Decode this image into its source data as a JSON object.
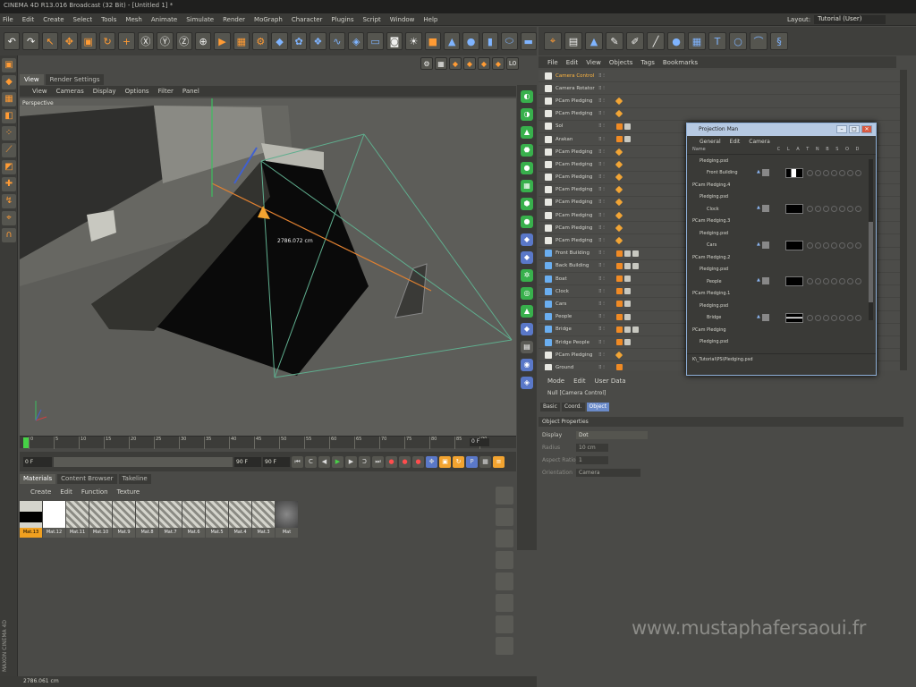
{
  "app": {
    "title": "CINEMA 4D R13.016 Broadcast (32 Bit) - [Untitled 1] *",
    "layout_label": "Layout:",
    "layout_value": "Tutorial (User)"
  },
  "menu": [
    "File",
    "Edit",
    "Create",
    "Select",
    "Tools",
    "Mesh",
    "Animate",
    "Simulate",
    "Render",
    "MoGraph",
    "Character",
    "Plugins",
    "Script",
    "Window",
    "Help"
  ],
  "viewport": {
    "tabs": [
      "View",
      "Render Settings"
    ],
    "menu": [
      "View",
      "Cameras",
      "Display",
      "Options",
      "Filter",
      "Panel"
    ],
    "label": "Perspective",
    "measure": "2786.072 cm"
  },
  "timeline": {
    "ticks": [
      "0",
      "5",
      "10",
      "15",
      "20",
      "25",
      "30",
      "35",
      "40",
      "45",
      "50",
      "55",
      "60",
      "65",
      "70",
      "75",
      "80",
      "85",
      "90"
    ],
    "frame_end": "0 F",
    "start": "0 F",
    "end_field": "90 F",
    "range_end": "90 F"
  },
  "materials": {
    "tabs": [
      "Materials",
      "Content Browser",
      "Takeline"
    ],
    "menu": [
      "Create",
      "Edit",
      "Function",
      "Texture"
    ],
    "items": [
      "Mat.13",
      "Mat.12",
      "Mat.11",
      "Mat.10",
      "Mat.9",
      "Mat.8",
      "Mat.7",
      "Mat.6",
      "Mat.5",
      "Mat.4",
      "Mat.3",
      "Mat"
    ],
    "selected_index": 0
  },
  "status": {
    "text": "2786.061 cm"
  },
  "side_logo": "MAXON CINEMA 4D",
  "object_manager": {
    "menu": [
      "File",
      "Edit",
      "View",
      "Objects",
      "Tags",
      "Bookmarks"
    ],
    "rows": [
      {
        "name": "Camera Control",
        "type": "null",
        "highlight": true,
        "tags": []
      },
      {
        "name": "Camera Rotator",
        "type": "null",
        "highlight": false,
        "tags": []
      },
      {
        "name": "PCam Pledging",
        "type": "obj",
        "highlight": false,
        "tags": [
          "c"
        ]
      },
      {
        "name": "PCam Pledging",
        "type": "obj",
        "highlight": false,
        "tags": [
          "c"
        ]
      },
      {
        "name": "Sol",
        "type": "obj",
        "highlight": false,
        "tags": [
          "o",
          "x"
        ]
      },
      {
        "name": "Arakan",
        "type": "obj",
        "highlight": false,
        "tags": [
          "o",
          "x"
        ]
      },
      {
        "name": "PCam Pledging",
        "type": "obj",
        "highlight": false,
        "tags": [
          "c"
        ]
      },
      {
        "name": "PCam Pledging",
        "type": "obj",
        "highlight": false,
        "tags": [
          "c"
        ]
      },
      {
        "name": "PCam Pledging",
        "type": "obj",
        "highlight": false,
        "tags": [
          "c"
        ]
      },
      {
        "name": "PCam Pledging",
        "type": "obj",
        "highlight": false,
        "tags": [
          "c"
        ]
      },
      {
        "name": "PCam Pledging",
        "type": "obj",
        "highlight": false,
        "tags": [
          "c"
        ]
      },
      {
        "name": "PCam Pledging",
        "type": "obj",
        "highlight": false,
        "tags": [
          "c"
        ]
      },
      {
        "name": "PCam Pledging",
        "type": "obj",
        "highlight": false,
        "tags": [
          "c"
        ]
      },
      {
        "name": "PCam Pledging",
        "type": "obj",
        "highlight": false,
        "tags": [
          "c"
        ]
      },
      {
        "name": "Front Building",
        "type": "cam",
        "highlight": false,
        "tags": [
          "o",
          "x",
          "x"
        ]
      },
      {
        "name": "Back Building",
        "type": "cam",
        "highlight": false,
        "tags": [
          "o",
          "x",
          "x"
        ]
      },
      {
        "name": "Boat",
        "type": "cam",
        "highlight": false,
        "tags": [
          "o",
          "x"
        ]
      },
      {
        "name": "Clock",
        "type": "cam",
        "highlight": false,
        "tags": [
          "o",
          "x"
        ]
      },
      {
        "name": "Cars",
        "type": "cam",
        "highlight": false,
        "tags": [
          "o",
          "x"
        ]
      },
      {
        "name": "People",
        "type": "cam",
        "highlight": false,
        "tags": [
          "o",
          "x"
        ]
      },
      {
        "name": "Bridge",
        "type": "cam",
        "highlight": false,
        "tags": [
          "o",
          "x",
          "x"
        ]
      },
      {
        "name": "Bridge People",
        "type": "cam",
        "highlight": false,
        "tags": [
          "o",
          "x"
        ]
      },
      {
        "name": "PCam Pledging",
        "type": "obj",
        "highlight": false,
        "tags": [
          "c"
        ]
      },
      {
        "name": "Ground",
        "type": "obj",
        "highlight": false,
        "tags": [
          "o"
        ]
      }
    ]
  },
  "attributes": {
    "menu": [
      "Mode",
      "Edit",
      "User Data"
    ],
    "title": "Null [Camera Control]",
    "tabs": [
      "Basic",
      "Coord.",
      "Object"
    ],
    "section": "Object Properties",
    "props": [
      {
        "label": "Display",
        "value": "Dot",
        "dim": false
      },
      {
        "label": "Radius",
        "value": "10 cm",
        "dim": true
      },
      {
        "label": "Aspect Ratio",
        "value": "1",
        "dim": true
      },
      {
        "label": "Orientation",
        "value": "Camera",
        "dim": true
      }
    ]
  },
  "projection_man": {
    "title": "Projection Man",
    "menu": [
      "General",
      "Edit",
      "Camera"
    ],
    "header": {
      "name": "Name",
      "cols": "C L A T N B S O D"
    },
    "rows": [
      {
        "name": "Pledging.psd",
        "indent": 1,
        "swatch": false
      },
      {
        "name": "Front Building",
        "indent": 2,
        "swatch": true
      },
      {
        "name": "PCam Pledging.4",
        "indent": 0,
        "swatch": false
      },
      {
        "name": "Pledging.psd",
        "indent": 1,
        "swatch": false
      },
      {
        "name": "Clock",
        "indent": 2,
        "swatch": true
      },
      {
        "name": "PCam Pledging.3",
        "indent": 0,
        "swatch": false
      },
      {
        "name": "Pledging.psd",
        "indent": 1,
        "swatch": false
      },
      {
        "name": "Cars",
        "indent": 2,
        "swatch": true
      },
      {
        "name": "PCam Pledging.2",
        "indent": 0,
        "swatch": false
      },
      {
        "name": "Pledging.psd",
        "indent": 1,
        "swatch": false
      },
      {
        "name": "People",
        "indent": 2,
        "swatch": true
      },
      {
        "name": "PCam Pledging.1",
        "indent": 0,
        "swatch": false
      },
      {
        "name": "Pledging.psd",
        "indent": 1,
        "swatch": false
      },
      {
        "name": "Bridge",
        "indent": 2,
        "swatch": true
      },
      {
        "name": "PCam Pledging",
        "indent": 0,
        "swatch": false
      },
      {
        "name": "Pledging.psd",
        "indent": 1,
        "swatch": false
      }
    ],
    "footer": "K\\_Tutorial\\PS\\Pledging.psd"
  },
  "watermark": "www.mustaphafersaoui.fr",
  "colors": {
    "accent": "#f3a430",
    "active_tab": "#6a8ac8",
    "camera_green": "#38b04c",
    "window_border": "#8fb0d8"
  }
}
